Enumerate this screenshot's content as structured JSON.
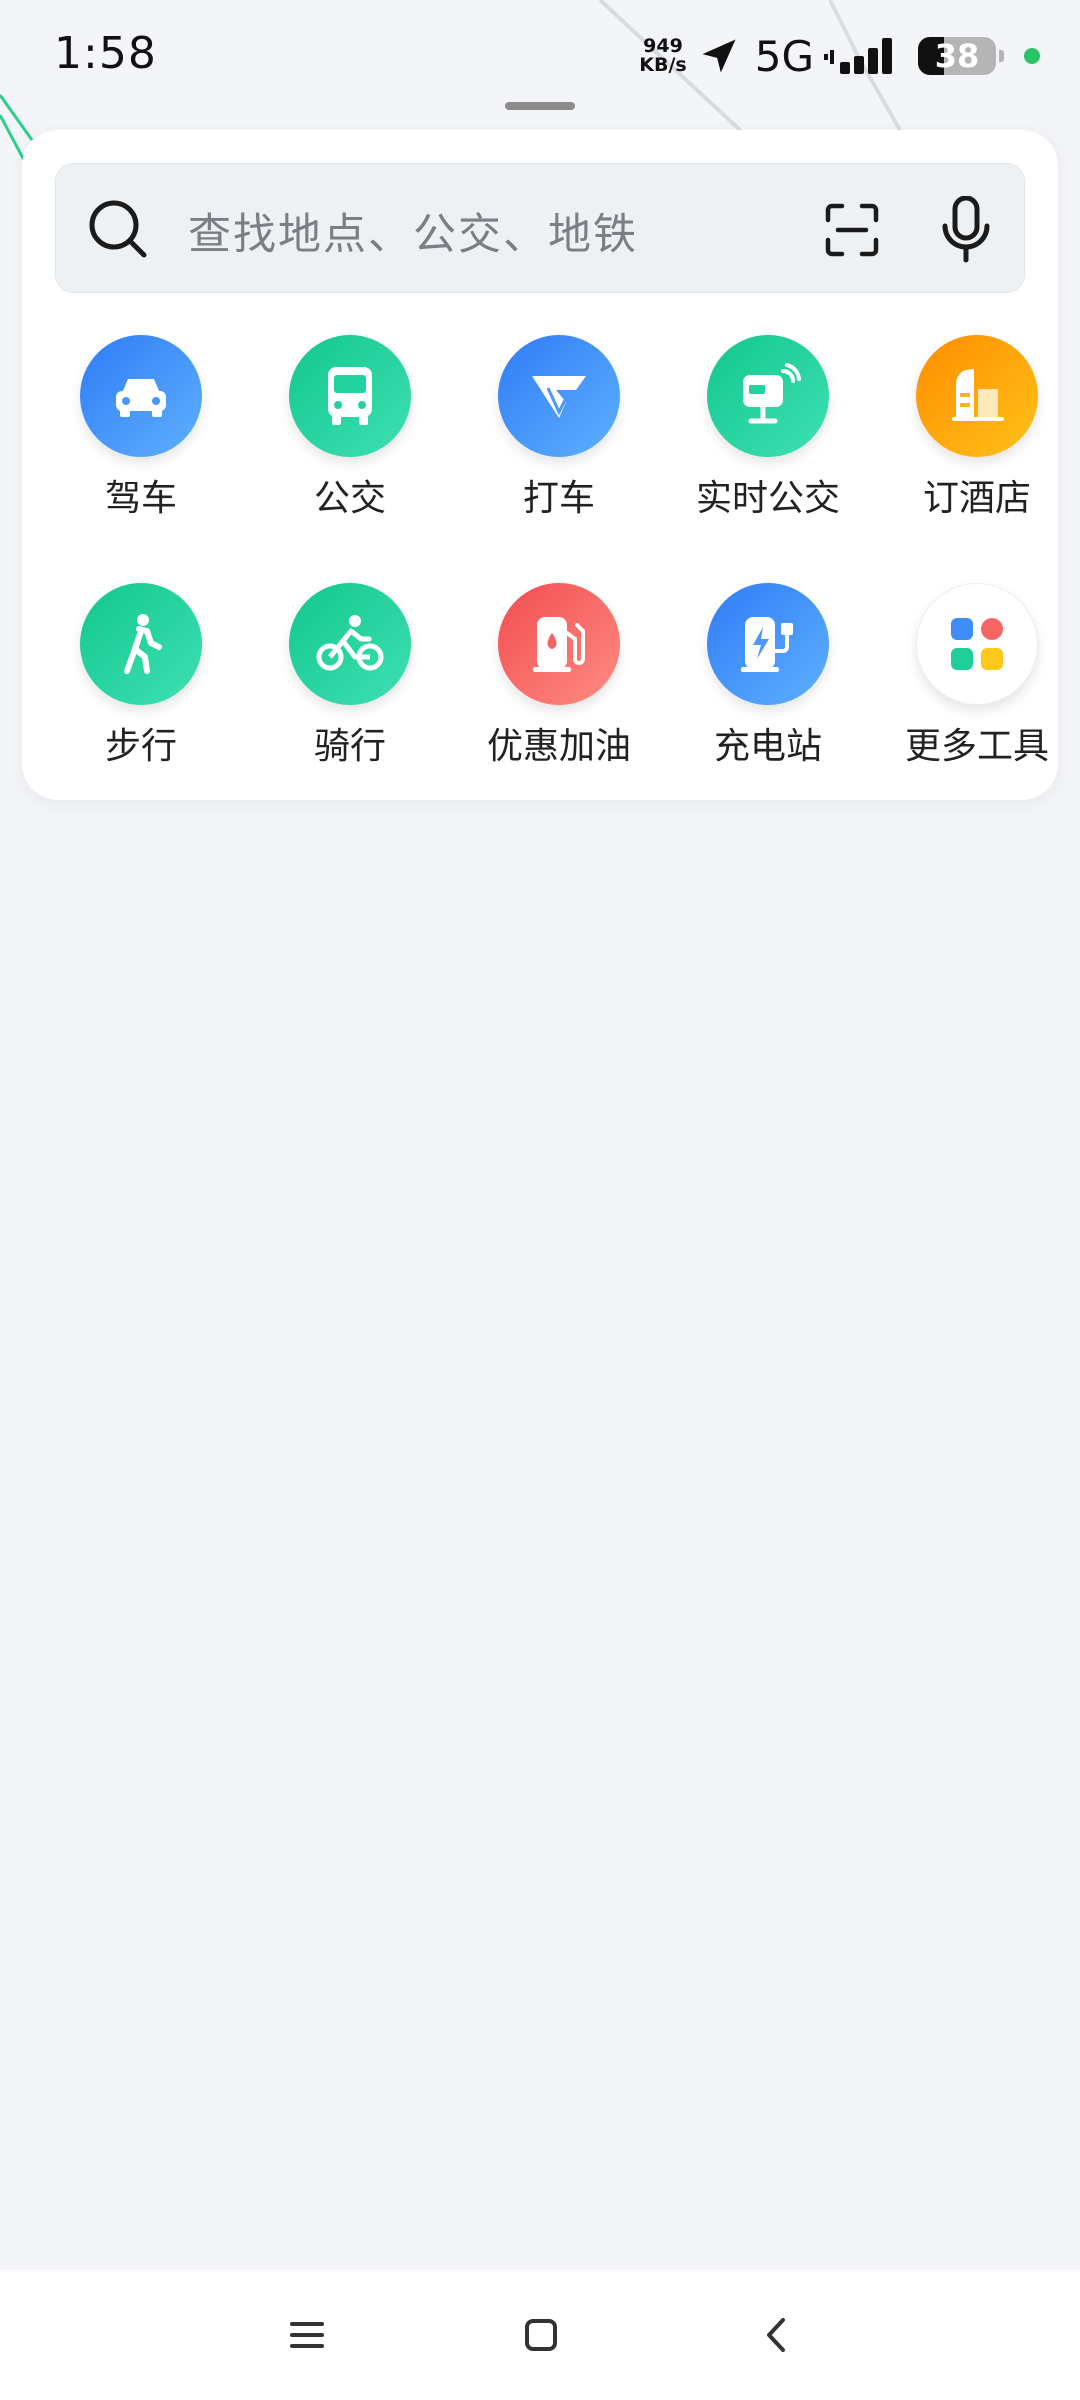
{
  "status_bar": {
    "time": "1:58",
    "net_speed_value": "949",
    "net_speed_unit": "KB/s",
    "network": "5G",
    "battery": "38",
    "location_icon": "location-arrow-icon",
    "signal_icon": "signal-bars-icon"
  },
  "search": {
    "placeholder": "查找地点、公交、地铁",
    "search_icon": "search-icon",
    "scan_icon": "scan-icon",
    "voice_icon": "microphone-icon"
  },
  "tools": [
    {
      "label": "驾车",
      "icon": "car-icon",
      "color": "#3d8ef8"
    },
    {
      "label": "公交",
      "icon": "bus-icon",
      "color": "#1fcf9a"
    },
    {
      "label": "打车",
      "icon": "taxi-icon",
      "color": "#3d8ef8"
    },
    {
      "label": "实时公交",
      "icon": "realtime-bus-icon",
      "color": "#1fcf9a"
    },
    {
      "label": "订酒店",
      "icon": "hotel-icon",
      "color": "#ffa20a"
    },
    {
      "label": "步行",
      "icon": "walk-icon",
      "color": "#1fcf9a"
    },
    {
      "label": "骑行",
      "icon": "bicycle-icon",
      "color": "#1fcf9a"
    },
    {
      "label": "优惠加油",
      "icon": "fuel-icon",
      "color": "#f56563"
    },
    {
      "label": "充电站",
      "icon": "charging-station-icon",
      "color": "#3d8ef8"
    },
    {
      "label": "更多工具",
      "icon": "more-tools-icon",
      "color": "#ffffff"
    }
  ],
  "nav_bar": {
    "menu_icon": "menu-icon",
    "home_icon": "home-icon",
    "back_icon": "back-icon"
  },
  "colors": {
    "background": "#f3f5f8",
    "card": "#ffffff",
    "map_route": "#2ecf8a"
  }
}
